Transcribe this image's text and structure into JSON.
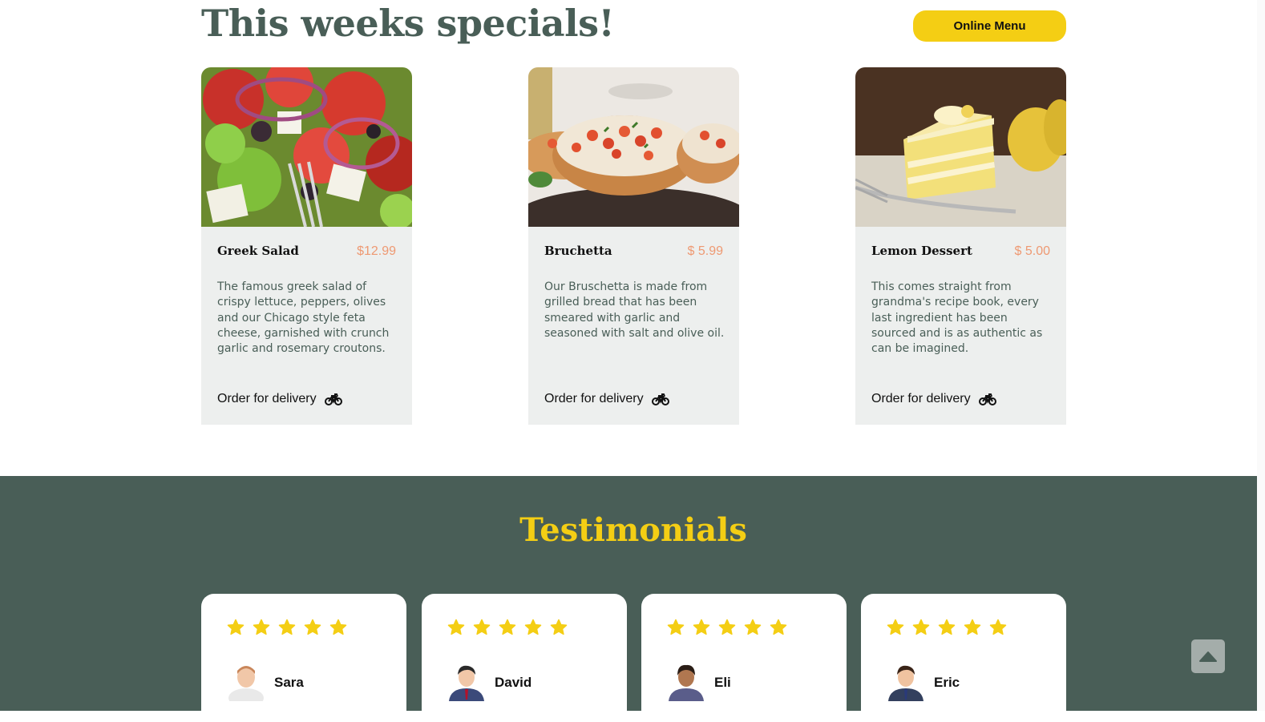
{
  "specials": {
    "title": "This weeks specials!",
    "menu_button": "Online Menu",
    "cards": [
      {
        "name": "Greek Salad",
        "price": "$12.99",
        "description": "The famous greek salad of crispy lettuce, peppers, olives and our Chicago style feta cheese, garnished with crunch garlic and rosemary croutons.",
        "order": "Order for delivery"
      },
      {
        "name": "Bruchetta",
        "price": "$ 5.99",
        "description": "Our Bruschetta is made from grilled bread that has been smeared with garlic and seasoned with salt and olive oil.",
        "order": "Order for delivery"
      },
      {
        "name": "Lemon Dessert",
        "price": "$ 5.00",
        "description": "This comes straight from grandma's recipe book, every last ingredient has been sourced and is as authentic as can be imagined.",
        "order": "Order for delivery"
      }
    ]
  },
  "testimonials": {
    "title": "Testimonials",
    "reviews": [
      {
        "name": "Sara",
        "rating": 5
      },
      {
        "name": "David",
        "rating": 5
      },
      {
        "name": "Eli",
        "rating": 5
      },
      {
        "name": "Eric",
        "rating": 5
      }
    ]
  },
  "icons": {
    "delivery": "motorcycle-icon",
    "star": "star-icon",
    "scroll_top": "caret-up-icon"
  },
  "colors": {
    "primary_green": "#495e57",
    "primary_yellow": "#f4ce14",
    "price_salmon": "#ee9972",
    "card_bg": "#edefee"
  }
}
